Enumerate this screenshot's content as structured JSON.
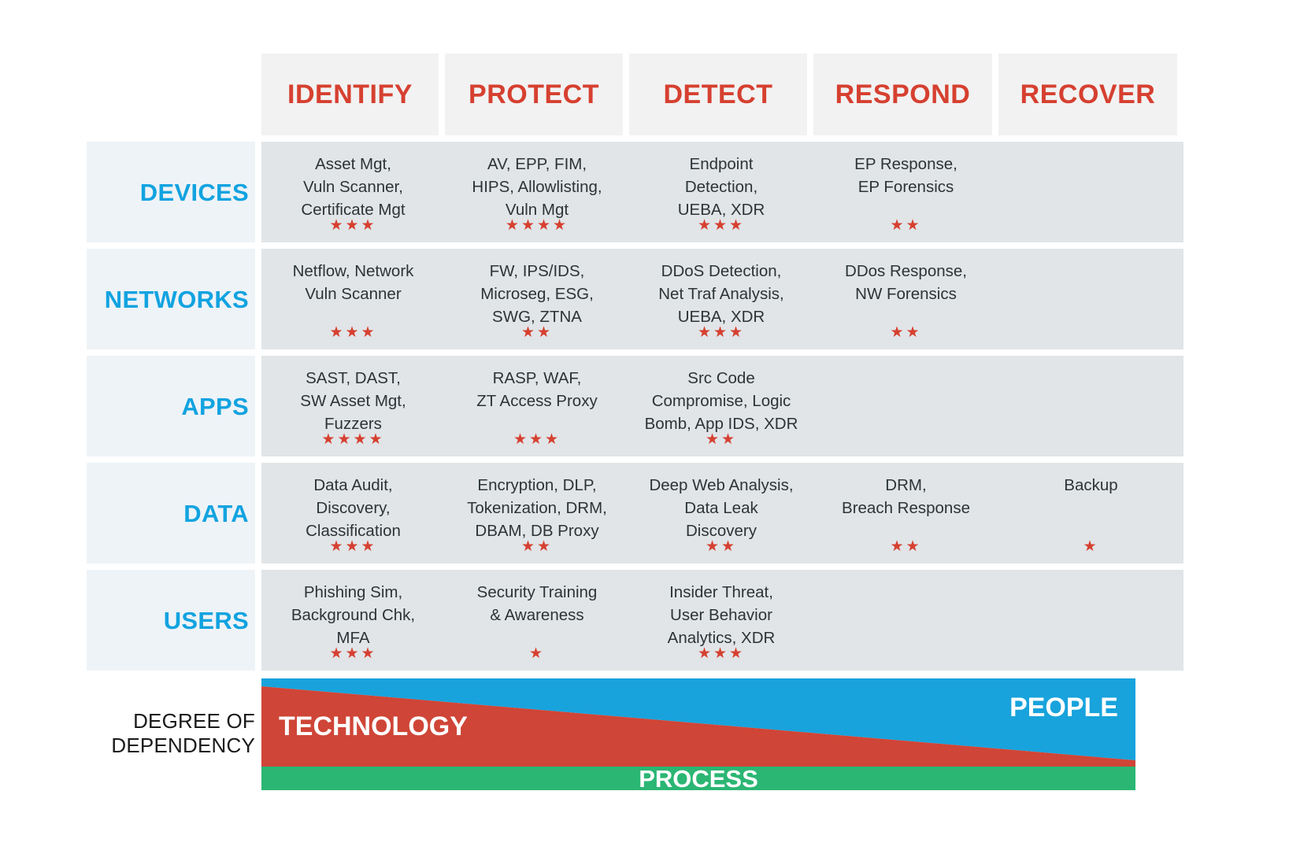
{
  "columns": [
    {
      "id": "identify",
      "label": "IDENTIFY"
    },
    {
      "id": "protect",
      "label": "PROTECT"
    },
    {
      "id": "detect",
      "label": "DETECT"
    },
    {
      "id": "respond",
      "label": "RESPOND"
    },
    {
      "id": "recover",
      "label": "RECOVER"
    }
  ],
  "rows": [
    {
      "id": "devices",
      "label": "DEVICES",
      "cells": [
        {
          "text": "Asset Mgt,\nVuln Scanner,\nCertificate Mgt",
          "stars": 3
        },
        {
          "text": "AV, EPP, FIM,\nHIPS, Allowlisting,\nVuln Mgt",
          "stars": 4
        },
        {
          "text": "Endpoint\nDetection,\nUEBA, XDR",
          "stars": 3
        },
        {
          "text": "EP Response,\nEP Forensics",
          "stars": 2
        },
        {
          "text": "",
          "stars": 0
        }
      ]
    },
    {
      "id": "networks",
      "label": "NETWORKS",
      "cells": [
        {
          "text": "Netflow, Network\nVuln Scanner",
          "stars": 3
        },
        {
          "text": "FW, IPS/IDS,\nMicroseg, ESG,\nSWG, ZTNA",
          "stars": 2
        },
        {
          "text": "DDoS Detection,\nNet Traf Analysis,\nUEBA, XDR",
          "stars": 3
        },
        {
          "text": "DDos Response,\nNW Forensics",
          "stars": 2
        },
        {
          "text": "",
          "stars": 0
        }
      ]
    },
    {
      "id": "apps",
      "label": "APPS",
      "cells": [
        {
          "text": "SAST, DAST,\nSW Asset Mgt,\nFuzzers",
          "stars": 4
        },
        {
          "text": "RASP, WAF,\nZT Access Proxy",
          "stars": 3
        },
        {
          "text": "Src Code\nCompromise, Logic\nBomb, App IDS, XDR",
          "stars": 2
        },
        {
          "text": "",
          "stars": 0
        },
        {
          "text": "",
          "stars": 0
        }
      ]
    },
    {
      "id": "data",
      "label": "DATA",
      "cells": [
        {
          "text": "Data Audit,\nDiscovery,\nClassification",
          "stars": 3
        },
        {
          "text": "Encryption, DLP,\nTokenization, DRM,\nDBAM, DB Proxy",
          "stars": 2
        },
        {
          "text": "Deep Web Analysis,\nData Leak\nDiscovery",
          "stars": 2
        },
        {
          "text": "DRM,\nBreach Response",
          "stars": 2
        },
        {
          "text": "Backup",
          "stars": 1
        }
      ]
    },
    {
      "id": "users",
      "label": "USERS",
      "cells": [
        {
          "text": "Phishing Sim,\nBackground Chk,\nMFA",
          "stars": 3
        },
        {
          "text": "Security Training\n& Awareness",
          "stars": 1
        },
        {
          "text": "Insider Threat,\nUser Behavior\nAnalytics, XDR",
          "stars": 3
        },
        {
          "text": "",
          "stars": 0
        },
        {
          "text": "",
          "stars": 0
        }
      ]
    }
  ],
  "dependency": {
    "label_line1": "DEGREE OF",
    "label_line2": "DEPENDENCY",
    "bands": [
      {
        "id": "people",
        "label": "PEOPLE",
        "color": "#18a3dc"
      },
      {
        "id": "technology",
        "label": "TECHNOLOGY",
        "color": "#cf4537"
      },
      {
        "id": "process",
        "label": "PROCESS",
        "color": "#2bb673"
      }
    ]
  },
  "colors": {
    "header_bg": "#f2f2f2",
    "header_text": "#d64030",
    "rowlabel_bg": "#eef3f7",
    "rowlabel_text": "#12a3e0",
    "cell_bg": "#e1e5e8",
    "cell_text": "#2d3436",
    "star": "#d64030",
    "people": "#18a3dc",
    "technology": "#cf4537",
    "process": "#2bb673"
  },
  "icons": {
    "star": "star-icon"
  }
}
